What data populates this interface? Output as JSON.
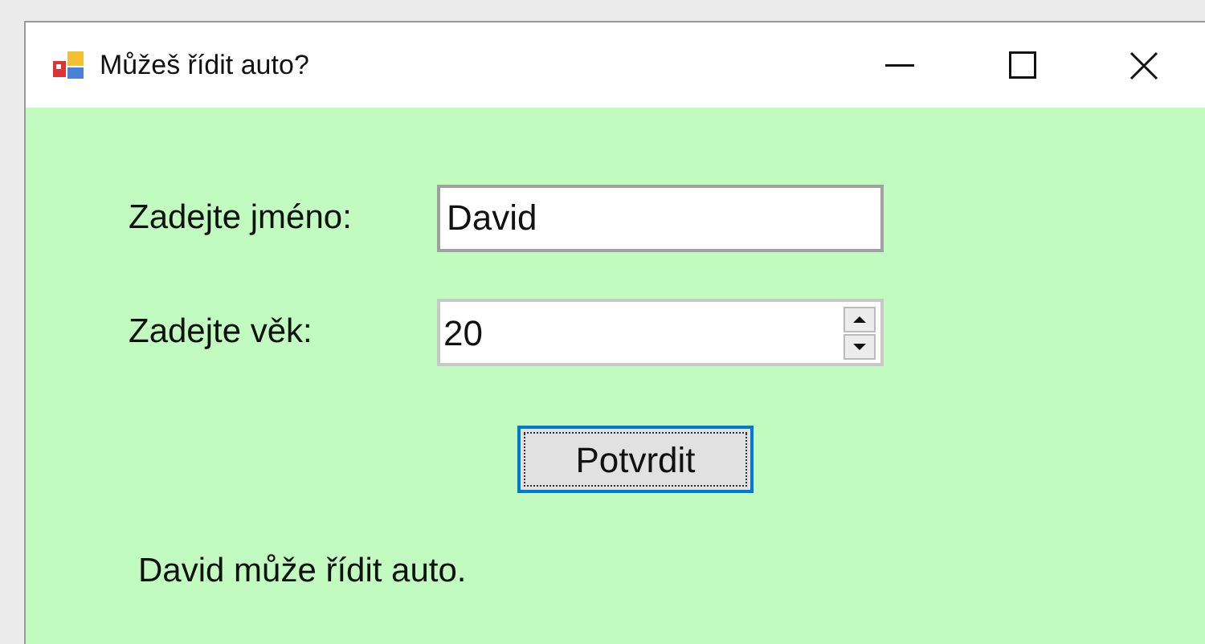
{
  "window": {
    "title": "Můžeš řídit auto?"
  },
  "fields": [
    {
      "kind": "text",
      "label": "Zadejte jméno:",
      "value": "David"
    },
    {
      "kind": "number",
      "label": "Zadejte věk:",
      "value": "20"
    }
  ],
  "button": {
    "label": "Potvrdit",
    "focused": true
  },
  "result": "David může řídit auto."
}
